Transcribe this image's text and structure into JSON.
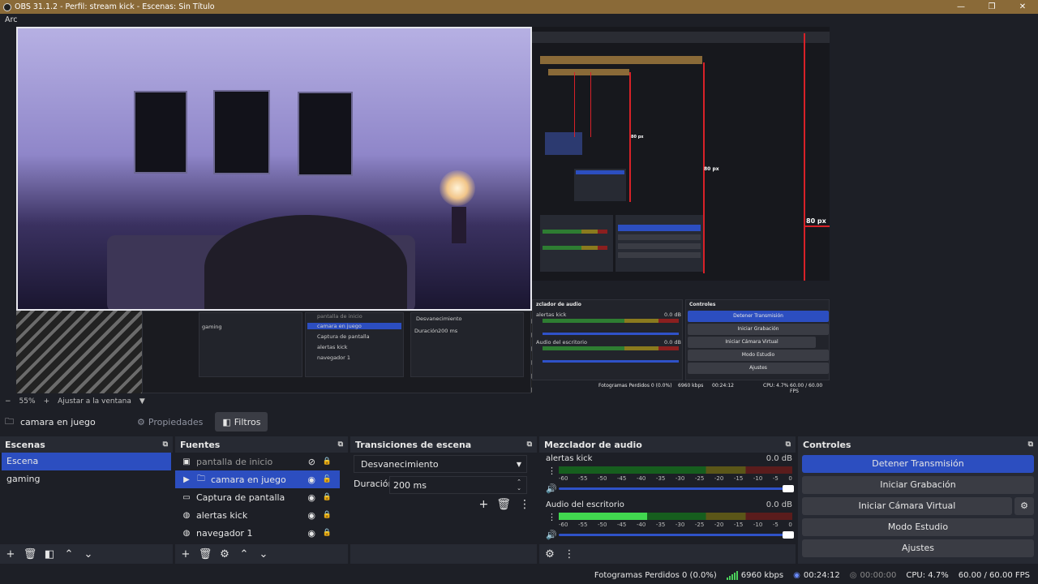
{
  "titlebar": {
    "title": "OBS 31.1.2 - Perfil: stream kick - Escenas: Sin Título",
    "minimize": "—",
    "maximize": "❐",
    "close": "✕"
  },
  "menubar": {
    "first": "Arc"
  },
  "preview_overlay": {
    "label_80px_a": "80 px",
    "label_80px_b": "80 px",
    "label_80px_c": "80 px",
    "mini_scene_gaming": "gaming",
    "mini_src_1": "pantalla de inicio",
    "mini_src_2": "camara en juego",
    "mini_src_3": "Captura de pantalla",
    "mini_src_4": "alertas kick",
    "mini_src_5": "navegador 1",
    "mini_trans": "Desvanecimiento",
    "mini_dur": "Duración",
    "mini_dur_val": "200 ms",
    "mini_mixer_title": "zclador de audio",
    "mini_mixer_a": "alertas kick",
    "mini_mixer_b": "Audio del escritorio",
    "mini_db": "0.0 dB",
    "mini_ctrl_title": "Controles",
    "mini_btn_1": "Detener Transmisión",
    "mini_btn_2": "Iniciar Grabación",
    "mini_btn_3": "Iniciar Cámara Virtual",
    "mini_btn_4": "Modo Estudio",
    "mini_btn_5": "Ajustes",
    "mini_status": "Fotogramas Perdidos 0 (0.0%)",
    "mini_kbps": "6960 kbps",
    "mini_time": "00:24:12",
    "mini_cpu": "CPU: 4.7%",
    "mini_fps": "60.00 / 60.00 FPS"
  },
  "zoom": {
    "minus": "−",
    "percent": "55%",
    "plus": "+",
    "fit_label": "Ajustar a la ventana",
    "caret": "▼"
  },
  "source_bar": {
    "current_source": "camara en juego",
    "properties": "Propiedades",
    "filters": "Filtros"
  },
  "scenes": {
    "title": "Escenas",
    "items": [
      "Escena",
      "gaming"
    ]
  },
  "sources": {
    "title": "Fuentes",
    "items": [
      {
        "label": "pantalla de inicio"
      },
      {
        "label": "camara en juego"
      },
      {
        "label": "Captura de pantalla"
      },
      {
        "label": "alertas kick"
      },
      {
        "label": "navegador 1"
      }
    ]
  },
  "transitions": {
    "title": "Transiciones de escena",
    "selected": "Desvanecimiento",
    "duration_label": "Duración",
    "duration_value": "200 ms"
  },
  "mixer": {
    "title": "Mezclador de audio",
    "channels": [
      {
        "name": "alertas kick",
        "db": "0.0 dB",
        "level": 0.0
      },
      {
        "name": "Audio del escritorio",
        "db": "0.0 dB",
        "level": 0.38
      }
    ],
    "ticks": [
      "-60",
      "-55",
      "-50",
      "-45",
      "-40",
      "-35",
      "-30",
      "-25",
      "-20",
      "-15",
      "-10",
      "-5",
      "0"
    ]
  },
  "controls": {
    "title": "Controles",
    "stop_stream": "Detener Transmisión",
    "start_record": "Iniciar Grabación",
    "start_vcam": "Iniciar Cámara Virtual",
    "studio_mode": "Modo Estudio",
    "settings": "Ajustes"
  },
  "status": {
    "dropped": "Fotogramas Perdidos 0 (0.0%)",
    "kbps": "6960 kbps",
    "stream_time": "00:24:12",
    "record_time": "00:00:00",
    "cpu": "CPU: 4.7%",
    "fps": "60.00 / 60.00 FPS"
  },
  "colors": {
    "accent": "#2c4ec0",
    "titlebar": "#8a6a38",
    "panel": "#272a33",
    "bg": "#1d1f26",
    "red_guide": "#d82128"
  }
}
